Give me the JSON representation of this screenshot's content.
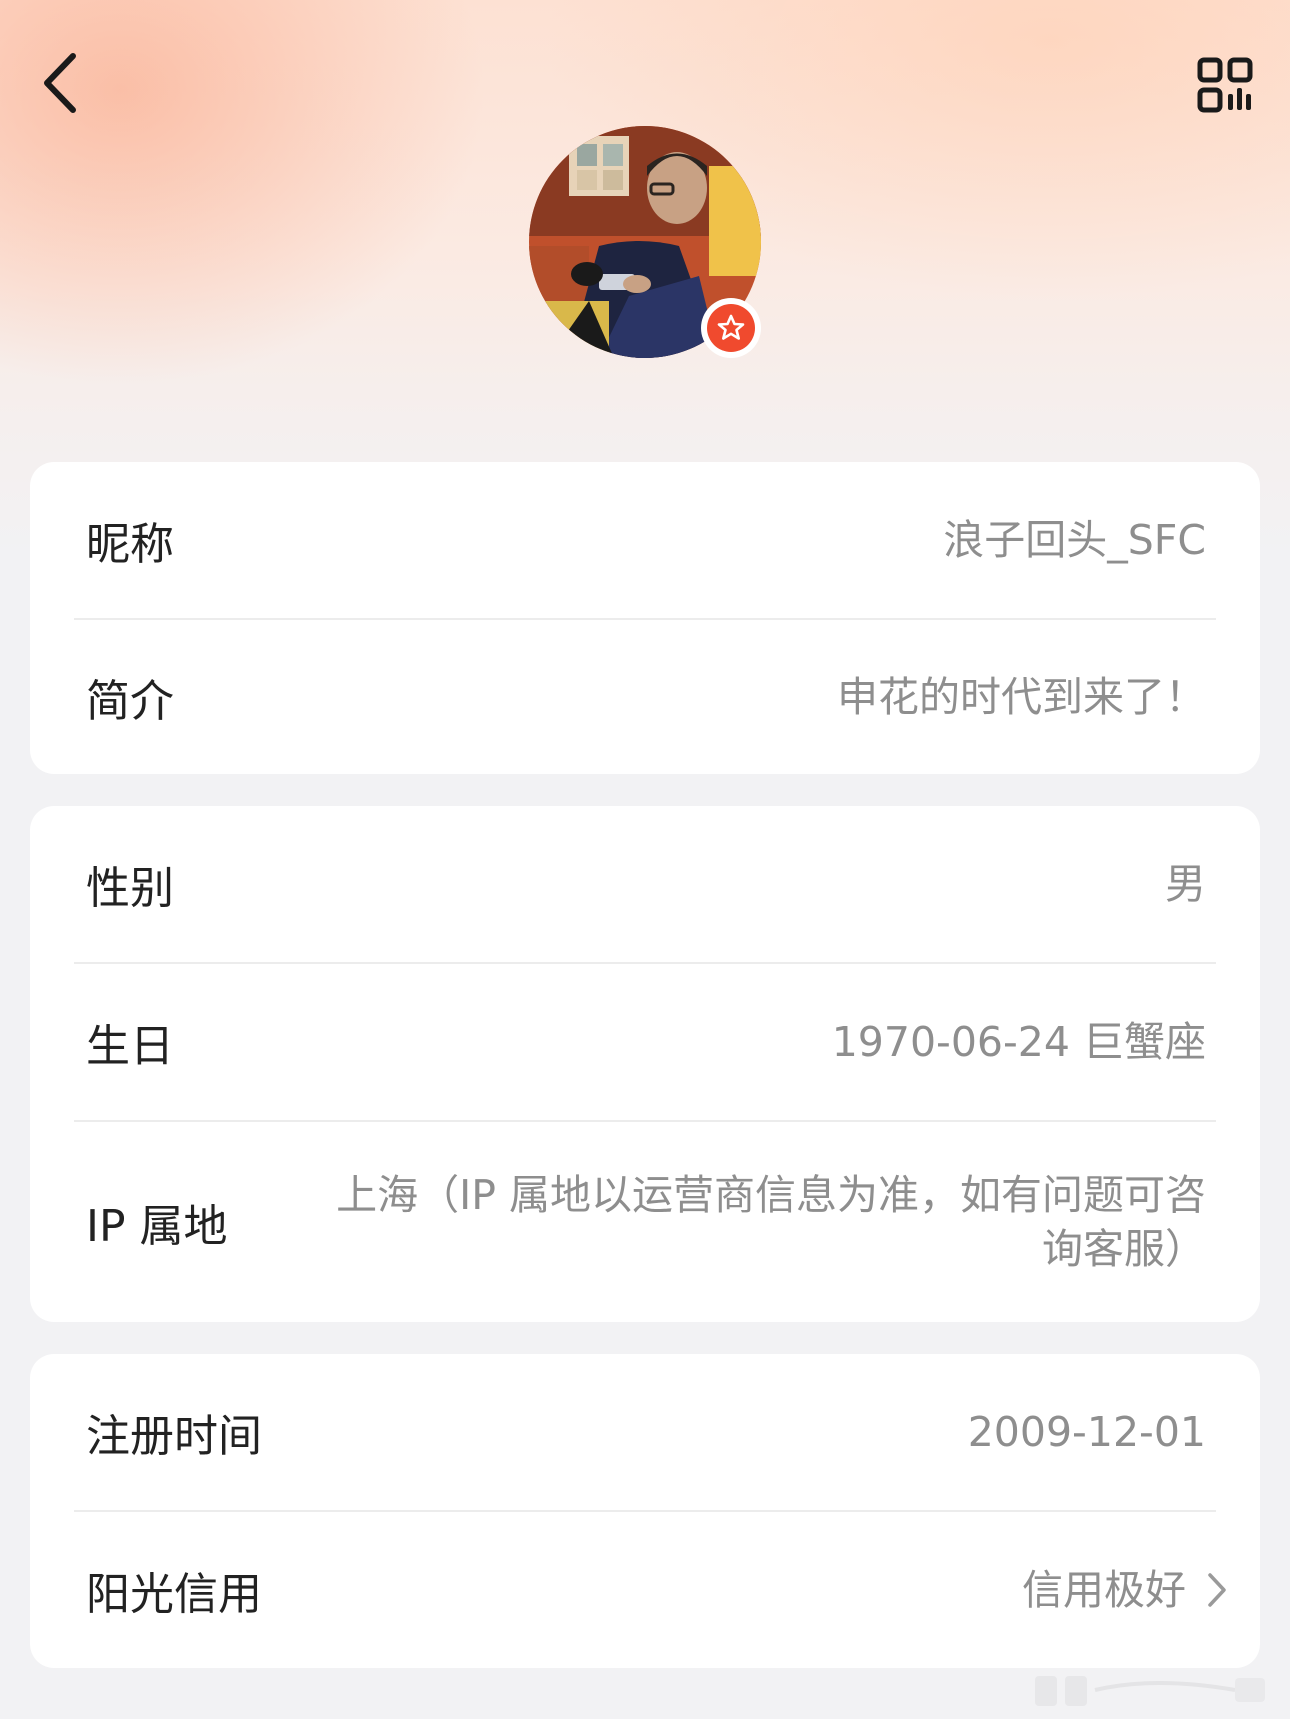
{
  "header": {
    "back_icon": "chevron-left-icon",
    "qr_icon": "qr-code-icon",
    "avatar_badge_icon": "star-badge-icon",
    "accent_color": "#f04a2e"
  },
  "section_basic": {
    "nickname": {
      "label": "昵称",
      "value": "浪子回头_SFC"
    },
    "bio": {
      "label": "简介",
      "value": "申花的时代到来了！"
    }
  },
  "section_personal": {
    "gender": {
      "label": "性别",
      "value": "男"
    },
    "birthday": {
      "label": "生日",
      "value": "1970-06-24 巨蟹座"
    },
    "ip": {
      "label": "IP 属地",
      "value": "上海（IP 属地以运营商信息为准，如有问题可咨询客服）"
    }
  },
  "section_account": {
    "register": {
      "label": "注册时间",
      "value": "2009-12-01"
    },
    "credit": {
      "label": "阳光信用",
      "value": "信用极好",
      "icon": "chevron-right-icon"
    }
  }
}
